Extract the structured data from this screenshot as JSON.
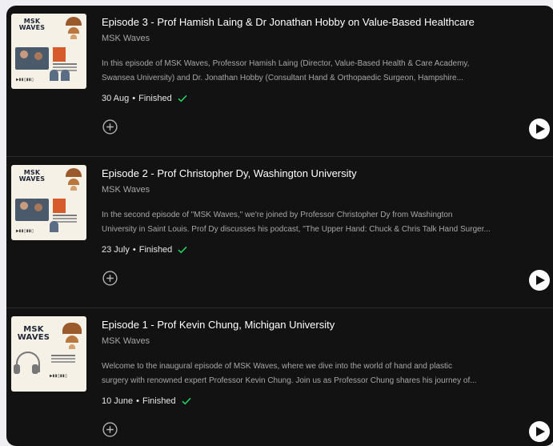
{
  "colors": {
    "panel_bg": "#121212",
    "page_bg": "#efeff3",
    "title_text": "#ffffff",
    "secondary_text": "#a7a7a7",
    "finished_check": "#1ed760",
    "divider": "#2b2b2b"
  },
  "icons": {
    "add": "plus-circle-icon",
    "play": "play-icon",
    "finished": "check-icon"
  },
  "episodes": [
    {
      "title": "Episode 3 - Prof Hamish Laing & Dr Jonathan Hobby on Value-Based Healthcare",
      "show": "MSK Waves",
      "description_line1": "In this episode of MSK Waves, Professor Hamish Laing (Director, Value-Based Health & Care Academy,",
      "description_line2": "Swansea University) and Dr. Jonathan Hobby (Consultant Hand & Orthopaedic Surgeon, Hampshire...",
      "date": "30 Aug",
      "status": "Finished",
      "cover_title": "MSK WAVES"
    },
    {
      "title": "Episode 2 - Prof Christopher Dy, Washington University",
      "show": "MSK Waves",
      "description_line1": "In the second episode of \"MSK Waves,\" we're joined by Professor Christopher Dy from Washington",
      "description_line2": "University in Saint Louis. Prof Dy discusses his podcast, \"The Upper Hand: Chuck & Chris Talk Hand Surger...",
      "date": "23 July",
      "status": "Finished",
      "cover_title": "MSK WAVES"
    },
    {
      "title": "Episode 1 - Prof Kevin Chung, Michigan University",
      "show": "MSK Waves",
      "description_line1": "Welcome to the inaugural episode of MSK Waves, where we dive into the world of hand and plastic",
      "description_line2": "surgery with renowned expert Professor Kevin Chung. Join us as Professor Chung shares his journey of...",
      "date": "10 June",
      "status": "Finished",
      "cover_title": "MSK WAVES"
    }
  ]
}
